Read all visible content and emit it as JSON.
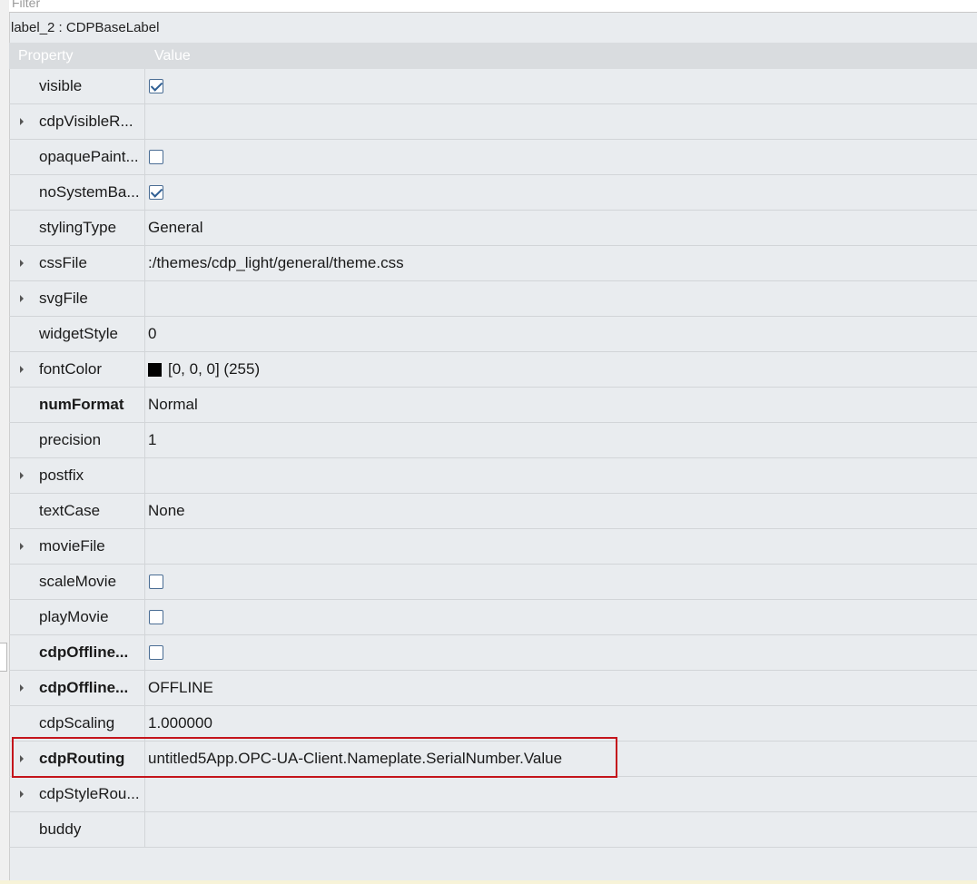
{
  "filter": {
    "placeholder": "Filter"
  },
  "object_name": "label_2 : CDPBaseLabel",
  "header": {
    "property": "Property",
    "value": "Value"
  },
  "rows": [
    {
      "name": "visible",
      "value": "",
      "checkbox": "checked",
      "expandable": false,
      "bold": false
    },
    {
      "name": "cdpVisibleR...",
      "value": "",
      "expandable": true,
      "bold": false
    },
    {
      "name": "opaquePaint...",
      "value": "",
      "checkbox": "unchecked",
      "expandable": false,
      "bold": false
    },
    {
      "name": "noSystemBa...",
      "value": "",
      "checkbox": "checked",
      "expandable": false,
      "bold": false
    },
    {
      "name": "stylingType",
      "value": "General",
      "expandable": false,
      "bold": false
    },
    {
      "name": "cssFile",
      "value": ":/themes/cdp_light/general/theme.css",
      "expandable": true,
      "bold": false
    },
    {
      "name": "svgFile",
      "value": "",
      "expandable": true,
      "bold": false
    },
    {
      "name": "widgetStyle",
      "value": "0",
      "expandable": false,
      "bold": false
    },
    {
      "name": "fontColor",
      "value": "[0, 0, 0] (255)",
      "swatch": "#000000",
      "expandable": true,
      "bold": false
    },
    {
      "name": "numFormat",
      "value": "Normal",
      "expandable": false,
      "bold": true
    },
    {
      "name": "precision",
      "value": "1",
      "expandable": false,
      "bold": false
    },
    {
      "name": "postfix",
      "value": "",
      "expandable": true,
      "bold": false
    },
    {
      "name": "textCase",
      "value": "None",
      "expandable": false,
      "bold": false
    },
    {
      "name": "movieFile",
      "value": "",
      "expandable": true,
      "bold": false
    },
    {
      "name": "scaleMovie",
      "value": "",
      "checkbox": "unchecked",
      "expandable": false,
      "bold": false
    },
    {
      "name": "playMovie",
      "value": "",
      "checkbox": "unchecked",
      "expandable": false,
      "bold": false
    },
    {
      "name": "cdpOffline...",
      "value": "",
      "checkbox": "unchecked",
      "expandable": false,
      "bold": true
    },
    {
      "name": "cdpOffline...",
      "value": "OFFLINE",
      "expandable": true,
      "bold": true
    },
    {
      "name": "cdpScaling",
      "value": "1.000000",
      "expandable": false,
      "bold": false
    },
    {
      "name": "cdpRouting",
      "value": "untitled5App.OPC-UA-Client.Nameplate.SerialNumber.Value",
      "expandable": true,
      "bold": true,
      "highlighted": true
    },
    {
      "name": "cdpStyleRou...",
      "value": "",
      "expandable": true,
      "bold": false
    },
    {
      "name": "buddy",
      "value": "",
      "expandable": false,
      "bold": false
    }
  ],
  "colors": {
    "highlight_border": "#c4151c",
    "header_bg": "#d9dcdf",
    "panel_bg": "#e9ecef"
  }
}
